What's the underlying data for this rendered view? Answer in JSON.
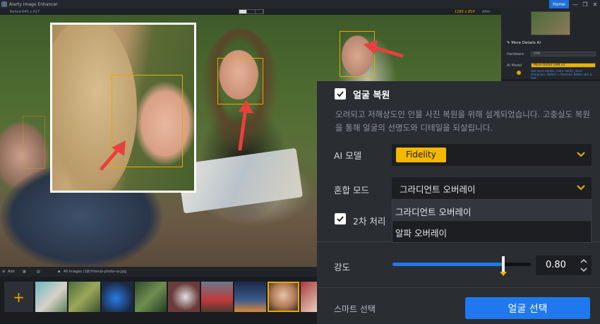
{
  "app": {
    "title": "Aiarty Image Enhancer",
    "home_label": "Home",
    "minimize_glyph": "—",
    "restore_glyph": "❐",
    "close_glyph": "✕"
  },
  "infobar": {
    "before_label": "Before",
    "before_size": "640 x 427",
    "after_size": "1280 x 854",
    "after_label": "After"
  },
  "sidepanel": {
    "section_title": "More Details AI",
    "hardware_label": "Hardware",
    "hardware_value": "CPU",
    "model_label": "AI Model",
    "model_value": "More-Detail GAN v2",
    "model_note": "Get more details, more clarity, more sharpness. Defect + Denoise, Better skin & hair."
  },
  "filmbar": {
    "add_label": "Add",
    "breadcrumb_root": "All Images (10)",
    "breadcrumb_sep": "/",
    "breadcrumb_file": "friends-photo-ss.jpg"
  },
  "settings": {
    "face_restore_title": "얼굴 복원",
    "face_restore_checked": true,
    "description": "오려되고 저해상도인 인물 사진 복원을 위해 설계되었습니다. 고충실도 복원을 통해 얼굴의 선명도와 디테일을 되살립니다.",
    "ai_model_label": "AI 모델",
    "ai_model_value": "Fidelity",
    "blend_mode_label": "혼합 모드",
    "blend_mode_value": "그라디언트 오버레이",
    "blend_options": [
      "그라디언트 오버레이",
      "알파 오버레이"
    ],
    "second_pass_label": "2차 처리",
    "second_pass_checked": true,
    "strength_label": "강도",
    "strength_value": "0.80",
    "strength_fraction": 0.8,
    "smart_select_label": "스마트 선택",
    "face_select_button": "얼굴 선택"
  },
  "colors": {
    "accent_blue": "#1f78ee",
    "face_box": "#e6a800",
    "arrow_red": "#e8403f",
    "fidelity_tag": "#f5b800"
  }
}
